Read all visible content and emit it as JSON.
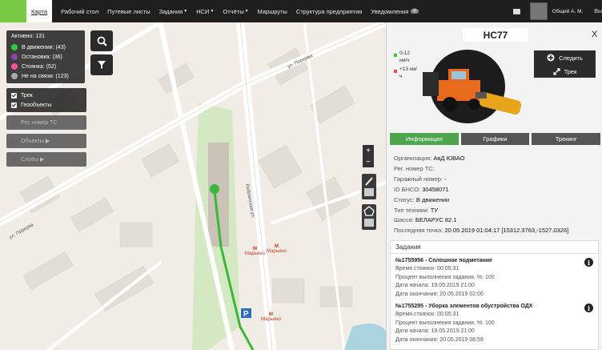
{
  "nav": {
    "items": [
      {
        "label": "Карта",
        "active": true
      },
      {
        "label": "Рабочий стол"
      },
      {
        "label": "Путевые листы"
      },
      {
        "label": "Задания",
        "dropdown": true
      },
      {
        "label": "НСИ",
        "dropdown": true
      },
      {
        "label": "Отчёты",
        "dropdown": true
      },
      {
        "label": "Маршруты"
      },
      {
        "label": "Структура предприятия"
      },
      {
        "label": "Уведомления",
        "badge": "0"
      }
    ],
    "user_name": "Общий А. М.",
    "exit_label": "Вы"
  },
  "status": {
    "title": "Активно: 131",
    "items": [
      {
        "label": "В движении: (43)",
        "color": "#2ecc40"
      },
      {
        "label": "Остановка: (36)",
        "color": "#8e44ad"
      },
      {
        "label": "Стоянка: (52)",
        "color": "#ff4fa0"
      },
      {
        "label": "Не на связи: (123)",
        "color": "#aaaaaa"
      }
    ]
  },
  "layers": {
    "track": "Трек",
    "geo": "Геообъекты"
  },
  "filters": {
    "reg": "Рег. номер ТС",
    "objects": "Объекты ▶",
    "layers": "Слоёы ▶"
  },
  "map": {
    "street1": "ул. Перерва",
    "street2": "ул. Перерва",
    "street3": "Люблинская ул.",
    "metro1": "Марьино",
    "metro2": "Марьино",
    "metro3": "Марьино"
  },
  "vehicle": {
    "title": "НС77",
    "speed1": "0-12 км/ч",
    "speed2": "+13 км/ч",
    "follow": "Следить",
    "track": "Трек"
  },
  "tabs": [
    "Информация",
    "Графики",
    "Трекинг"
  ],
  "info": [
    {
      "label": "Организация:",
      "value": "АвД ЮВАО"
    },
    {
      "label": "Рег. номер ТС:",
      "value": ""
    },
    {
      "label": "Гаражный номер:",
      "value": "-"
    },
    {
      "label": "ID БНСО:",
      "value": "30458071"
    },
    {
      "label": "Статус:",
      "value": "В движении"
    },
    {
      "label": "Тип техники:",
      "value": "ТУ"
    },
    {
      "label": "Шасси:",
      "value": "БЕЛАРУС 82.1"
    },
    {
      "label": "Последняя точка:",
      "value": "20.05.2019 01:04:17 [15312.3763,-1527.0326]"
    }
  ],
  "tasks": {
    "title": "Задания",
    "items": [
      {
        "title": "№1755956 - Сплошное подметание",
        "stay": "Время стоянок: 00:05:31",
        "percent": "Процент выполнения задания, %: 100",
        "start": "Дата начала: 19.05.2019 21:00",
        "end": "Дата окончания: 20.05.2019 02:00"
      },
      {
        "title": "№1755295 - Уборка элементов обустройства ОДХ",
        "stay": "Время стоянок: 00:05:31",
        "percent": "Процент выполнения задания, %: 100",
        "start": "Дата начала: 19.05.2019 21:00",
        "end": "Дата окончания: 20.05.2019 08:59"
      }
    ]
  }
}
